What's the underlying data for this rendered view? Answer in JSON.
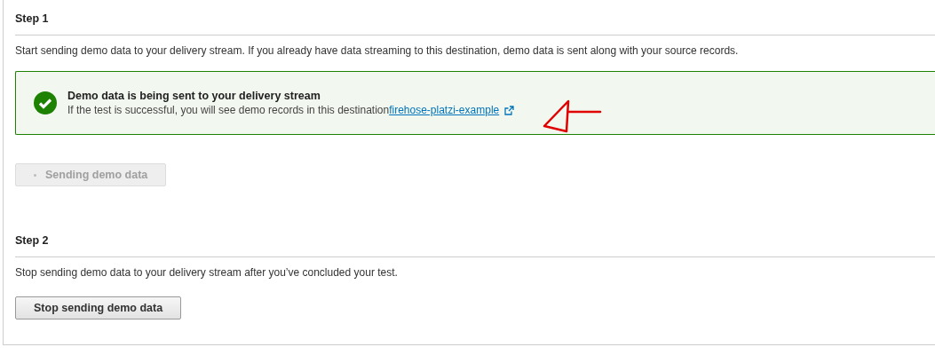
{
  "steps": [
    {
      "title": "Step 1",
      "description": "Start sending demo data to your delivery stream. If you already have data streaming to this destination, demo data is sent along with your source records.",
      "alert": {
        "kind": "success",
        "title": "Demo data is being sent to your delivery stream",
        "text": "If the test is successful, you will see demo records in this destination",
        "link": "firehose-platzi-example"
      },
      "button": {
        "label": "Sending demo data",
        "disabled": true
      }
    },
    {
      "title": "Step 2",
      "description": "Stop sending demo data to your delivery stream after you’ve concluded your test.",
      "button": {
        "label": "Stop sending demo data",
        "disabled": false
      }
    }
  ],
  "annotations": [
    {
      "kind": "arrow"
    }
  ]
}
